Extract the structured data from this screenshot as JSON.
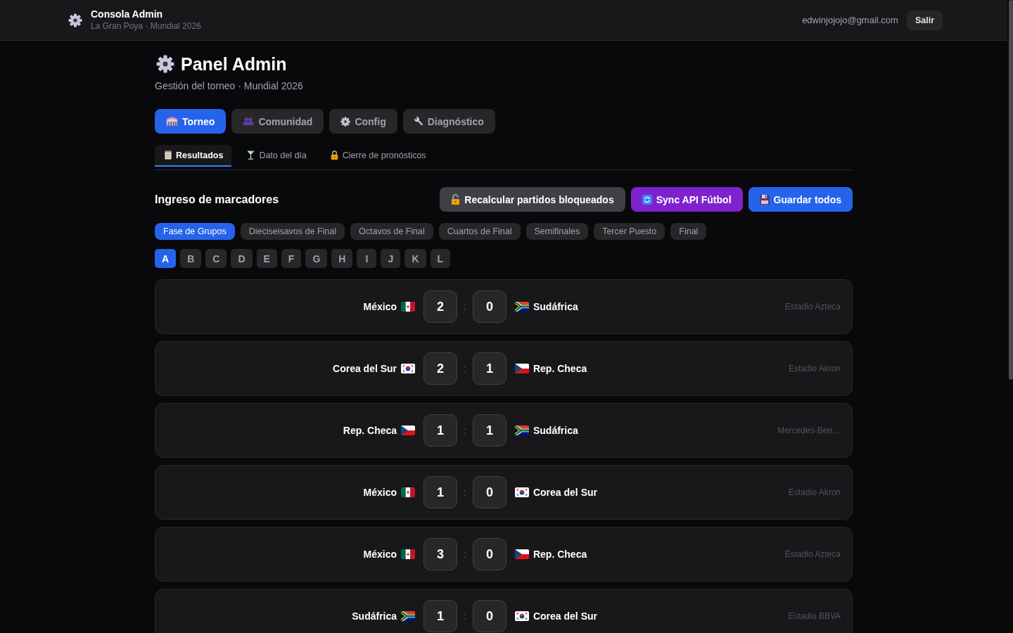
{
  "header": {
    "title": "Consola Admin",
    "subtitle": "La Gran Poya · Mundial 2026",
    "user_email": "edwinjojojo@gmail.com",
    "logout_button": "Salir"
  },
  "page": {
    "title": "Panel Admin",
    "subtitle": "Gestión del torneo · Mundial 2026"
  },
  "main_tabs": [
    {
      "label": "Torneo",
      "selected": true
    },
    {
      "label": "Comunidad",
      "selected": false
    },
    {
      "label": "Config",
      "selected": false
    },
    {
      "label": "Diagnóstico",
      "selected": false
    }
  ],
  "sub_tabs": [
    {
      "label": "Resultados",
      "selected": true
    },
    {
      "label": "Dato del día",
      "selected": false
    },
    {
      "label": "Cierre de pronósticos",
      "selected": false
    }
  ],
  "section": {
    "title": "Ingreso de marcadores",
    "actions": [
      {
        "label": "Recalcular partidos bloqueados",
        "kind": "recalculate"
      },
      {
        "label": "Sync API Fútbol",
        "kind": "sync"
      },
      {
        "label": "Guardar todos",
        "kind": "save"
      }
    ]
  },
  "phases": [
    {
      "label": "Fase de Grupos",
      "selected": true
    },
    {
      "label": "Dieciseisavos de Final",
      "selected": false
    },
    {
      "label": "Octavos de Final",
      "selected": false
    },
    {
      "label": "Cuartos de Final",
      "selected": false
    },
    {
      "label": "Semifinales",
      "selected": false
    },
    {
      "label": "Tercer Puesto",
      "selected": false
    },
    {
      "label": "Final",
      "selected": false
    }
  ],
  "groups": [
    {
      "label": "A",
      "selected": true
    },
    {
      "label": "B",
      "selected": false
    },
    {
      "label": "C",
      "selected": false
    },
    {
      "label": "D",
      "selected": false
    },
    {
      "label": "E",
      "selected": false
    },
    {
      "label": "F",
      "selected": false
    },
    {
      "label": "G",
      "selected": false
    },
    {
      "label": "H",
      "selected": false
    },
    {
      "label": "I",
      "selected": false
    },
    {
      "label": "J",
      "selected": false
    },
    {
      "label": "K",
      "selected": false
    },
    {
      "label": "L",
      "selected": false
    }
  ],
  "matches": [
    {
      "home": {
        "name": "México",
        "kind": "mexico"
      },
      "home_score": "2",
      "separator": ":",
      "away_score": "0",
      "away": {
        "name": "Sudáfrica",
        "kind": "southafrica"
      },
      "venue": "Estadio Azteca"
    },
    {
      "home": {
        "name": "Corea del Sur",
        "kind": "korea"
      },
      "home_score": "2",
      "separator": ":",
      "away_score": "1",
      "away": {
        "name": "Rep. Checa",
        "kind": "czechia"
      },
      "venue": "Estadio Akron"
    },
    {
      "home": {
        "name": "Rep. Checa",
        "kind": "czechia"
      },
      "home_score": "1",
      "separator": ":",
      "away_score": "1",
      "away": {
        "name": "Sudáfrica",
        "kind": "southafrica"
      },
      "venue": "Mercedes-Ben…"
    },
    {
      "home": {
        "name": "México",
        "kind": "mexico"
      },
      "home_score": "1",
      "separator": ":",
      "away_score": "0",
      "away": {
        "name": "Corea del Sur",
        "kind": "korea"
      },
      "venue": "Estadio Akron"
    },
    {
      "home": {
        "name": "México",
        "kind": "mexico"
      },
      "home_score": "3",
      "separator": ":",
      "away_score": "0",
      "away": {
        "name": "Rep. Checa",
        "kind": "czechia"
      },
      "venue": "Estadio Azteca"
    },
    {
      "home": {
        "name": "Sudáfrica",
        "kind": "southafrica"
      },
      "home_score": "1",
      "separator": ":",
      "away_score": "0",
      "away": {
        "name": "Corea del Sur",
        "kind": "korea"
      },
      "venue": "Estadio BBVA"
    }
  ]
}
